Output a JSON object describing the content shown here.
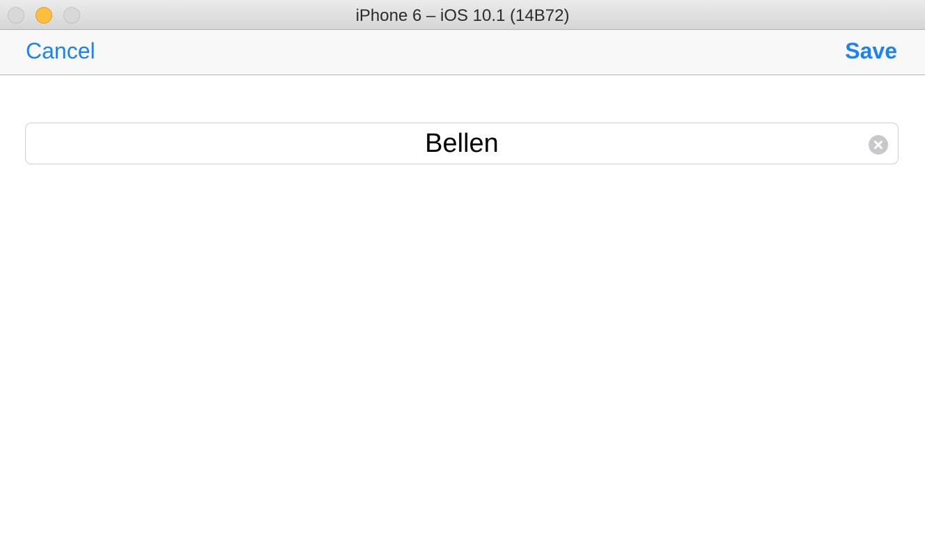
{
  "window": {
    "title": "iPhone 6 – iOS 10.1 (14B72)"
  },
  "navbar": {
    "cancel_label": "Cancel",
    "save_label": "Save",
    "accent_color": "#1a82f7"
  },
  "form": {
    "name_field": {
      "value": "Bellen",
      "clear_icon": "clear-circle-icon"
    }
  },
  "icons": {
    "traffic_lights": [
      "close-icon",
      "minimize-icon",
      "zoom-icon"
    ]
  }
}
